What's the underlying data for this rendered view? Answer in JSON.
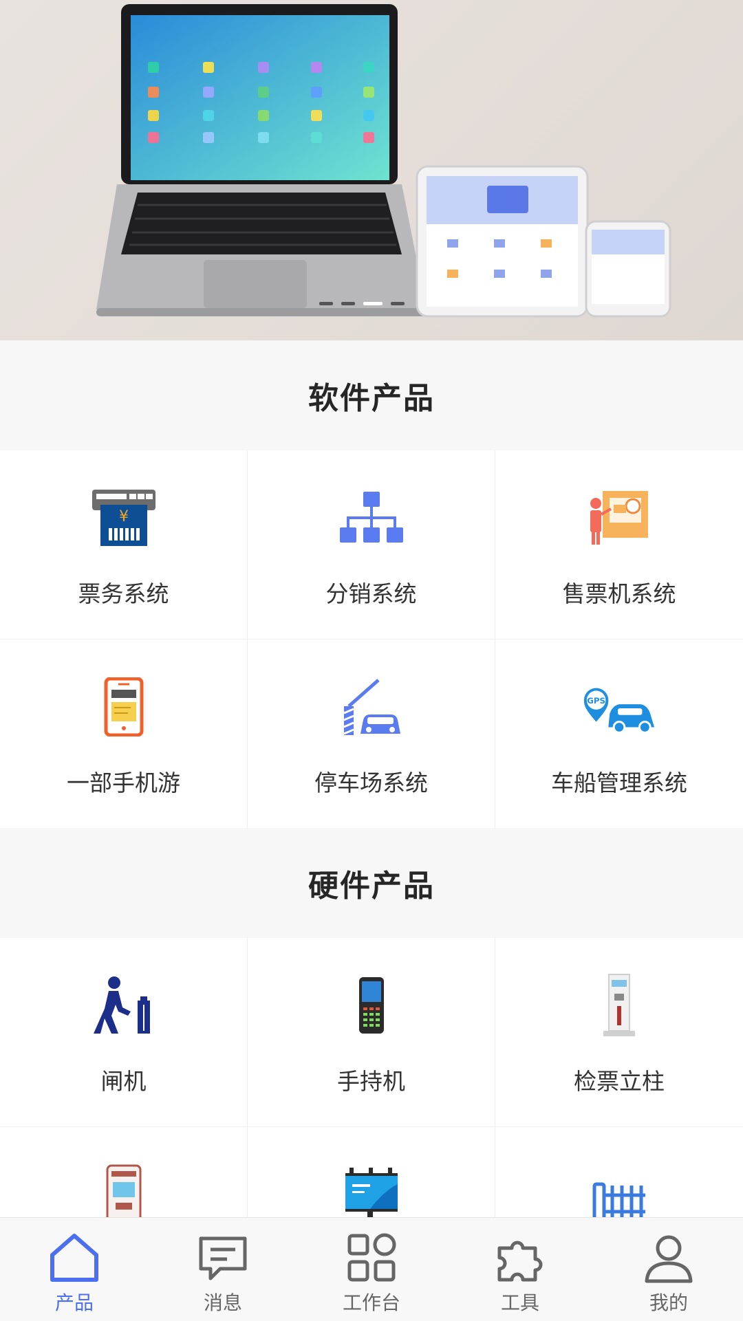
{
  "banner": {
    "slides": 4,
    "active_slide": 3
  },
  "software_section": {
    "title": "软件产品",
    "items": [
      {
        "label": "票务系统",
        "icon": "ticket-machine-icon"
      },
      {
        "label": "分销系统",
        "icon": "distribution-tree-icon"
      },
      {
        "label": "售票机系统",
        "icon": "ticket-kiosk-icon"
      },
      {
        "label": "一部手机游",
        "icon": "mobile-phone-icon"
      },
      {
        "label": "停车场系统",
        "icon": "parking-barrier-icon"
      },
      {
        "label": "车船管理系统",
        "icon": "gps-car-icon"
      }
    ]
  },
  "hardware_section": {
    "title": "硬件产品",
    "items": [
      {
        "label": "闸机",
        "icon": "turnstile-walker-icon"
      },
      {
        "label": "手持机",
        "icon": "handheld-terminal-icon"
      },
      {
        "label": "检票立柱",
        "icon": "ticket-pillar-icon"
      },
      {
        "label": "",
        "icon": "self-service-kiosk-icon"
      },
      {
        "label": "",
        "icon": "billboard-icon"
      },
      {
        "label": "",
        "icon": "gate-barrier-icon"
      }
    ]
  },
  "tabbar": {
    "active": 0,
    "tabs": [
      {
        "label": "产品",
        "icon": "home-icon"
      },
      {
        "label": "消息",
        "icon": "message-icon"
      },
      {
        "label": "工作台",
        "icon": "grid-icon"
      },
      {
        "label": "工具",
        "icon": "puzzle-icon"
      },
      {
        "label": "我的",
        "icon": "user-icon"
      }
    ]
  },
  "colors": {
    "accent": "#4c6ff0",
    "tab_inactive": "#666666"
  }
}
